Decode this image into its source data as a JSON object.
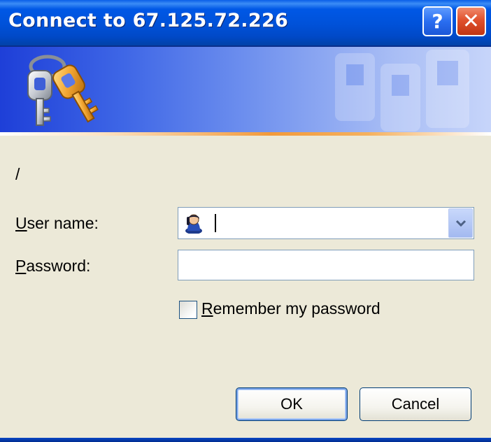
{
  "window": {
    "title": "Connect to 67.125.72.226"
  },
  "title_buttons": {
    "help_label": "?",
    "close_label": "✕"
  },
  "content": {
    "realm": "/",
    "username_label_accel": "U",
    "username_label_rest": "ser name:",
    "username_value": "",
    "password_label_accel": "P",
    "password_label_rest": "assword:",
    "password_value": "",
    "remember_accel": "R",
    "remember_rest": "emember my password",
    "remember_checked": false
  },
  "buttons": {
    "ok": "OK",
    "cancel": "Cancel"
  },
  "icons": {
    "banner": "keys-icon",
    "user_field": "user-icon",
    "dropdown": "chevron-down-icon"
  },
  "colors": {
    "titlebar": "#0058e6",
    "dialog_background": "#ece9d8",
    "close_button": "#e0512d",
    "banner_accent": "#f29a3a"
  }
}
